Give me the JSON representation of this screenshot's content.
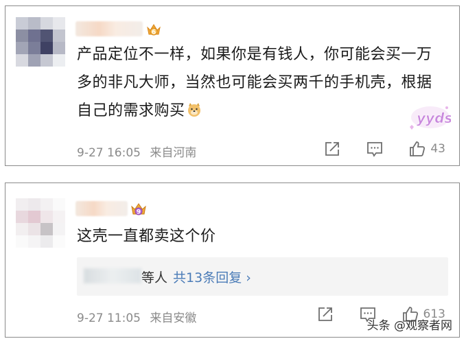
{
  "comments": [
    {
      "level": "6",
      "text": "产品定位不一样，如果你是有钱人，你可能会买一万多的非凡大师，当然也可能会买两千的手机壳，根据自己的需求购买",
      "emoji": "doge-emoji",
      "sticker": "yyds",
      "time": "9-27 16:05",
      "location": "来自河南",
      "likes": "43"
    },
    {
      "level": "9",
      "text": "这壳一直都卖这个价",
      "reply_prefix": "等人",
      "reply_link": "共13条回复 ›",
      "time": "9-27 11:05",
      "location": "来自安徽",
      "likes": "613"
    }
  ],
  "watermark": "头条 @观察者网",
  "colors": {
    "link": "#4a7bb7",
    "meta": "#8a8a8a",
    "border": "#8a8a8a"
  },
  "icons": [
    "share-icon",
    "comment-icon",
    "like-icon",
    "level-badge-icon"
  ]
}
